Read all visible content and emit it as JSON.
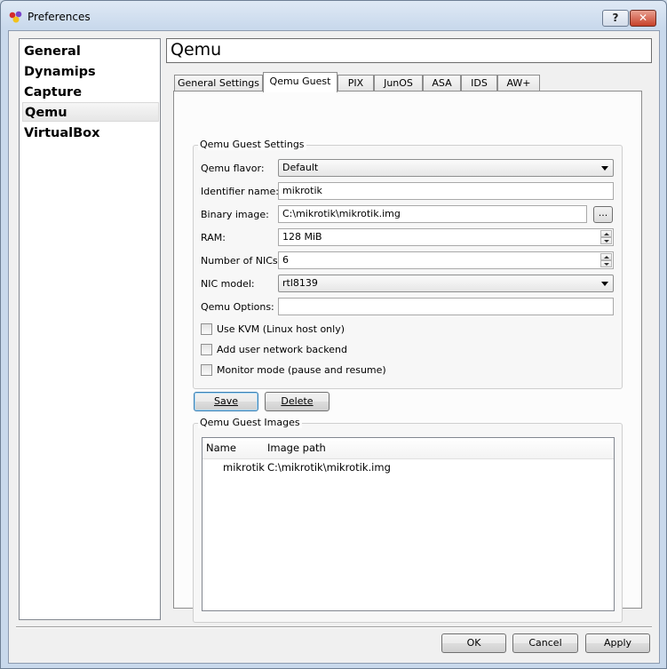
{
  "window": {
    "title": "Preferences",
    "help_label": "?",
    "close_label": "✕"
  },
  "sidebar": {
    "items": [
      {
        "label": "General"
      },
      {
        "label": "Dynamips"
      },
      {
        "label": "Capture"
      },
      {
        "label": "Qemu",
        "selected": true
      },
      {
        "label": "VirtualBox"
      }
    ]
  },
  "header": {
    "title": "Qemu"
  },
  "tabs": [
    {
      "label": "General Settings"
    },
    {
      "label": "Qemu Guest",
      "active": true
    },
    {
      "label": "PIX"
    },
    {
      "label": "JunOS"
    },
    {
      "label": "ASA"
    },
    {
      "label": "IDS"
    },
    {
      "label": "AW+"
    }
  ],
  "settings": {
    "group_title": "Qemu Guest Settings",
    "flavor_label": "Qemu flavor:",
    "flavor_value": "Default",
    "identifier_label": "Identifier name:",
    "identifier_value": "mikrotik",
    "binary_label": "Binary image:",
    "binary_value": "C:\\mikrotik\\mikrotik.img",
    "browse_label": "...",
    "ram_label": "RAM:",
    "ram_value": "128 MiB",
    "nics_label": "Number of NICs:",
    "nics_value": "6",
    "nic_model_label": "NIC model:",
    "nic_model_value": "rtl8139",
    "options_label": "Qemu Options:",
    "options_value": "",
    "kvm_label": "Use KVM (Linux host only)",
    "kvm_checked": false,
    "user_net_label": "Add user network backend",
    "user_net_checked": false,
    "monitor_label": "Monitor mode (pause and resume)",
    "monitor_checked": false
  },
  "actions": {
    "save_label": "Save",
    "delete_label": "Delete"
  },
  "images": {
    "group_title": "Qemu Guest Images",
    "columns": [
      "Name",
      "Image path"
    ],
    "rows": [
      {
        "name": "mikrotik",
        "path": "C:\\mikrotik\\mikrotik.img"
      }
    ]
  },
  "footer": {
    "ok_label": "OK",
    "cancel_label": "Cancel",
    "apply_label": "Apply"
  },
  "colors": {
    "title_bar": "#dfe9f5",
    "close_button": "#c7412a",
    "panel_bg": "#f0f0f0"
  }
}
